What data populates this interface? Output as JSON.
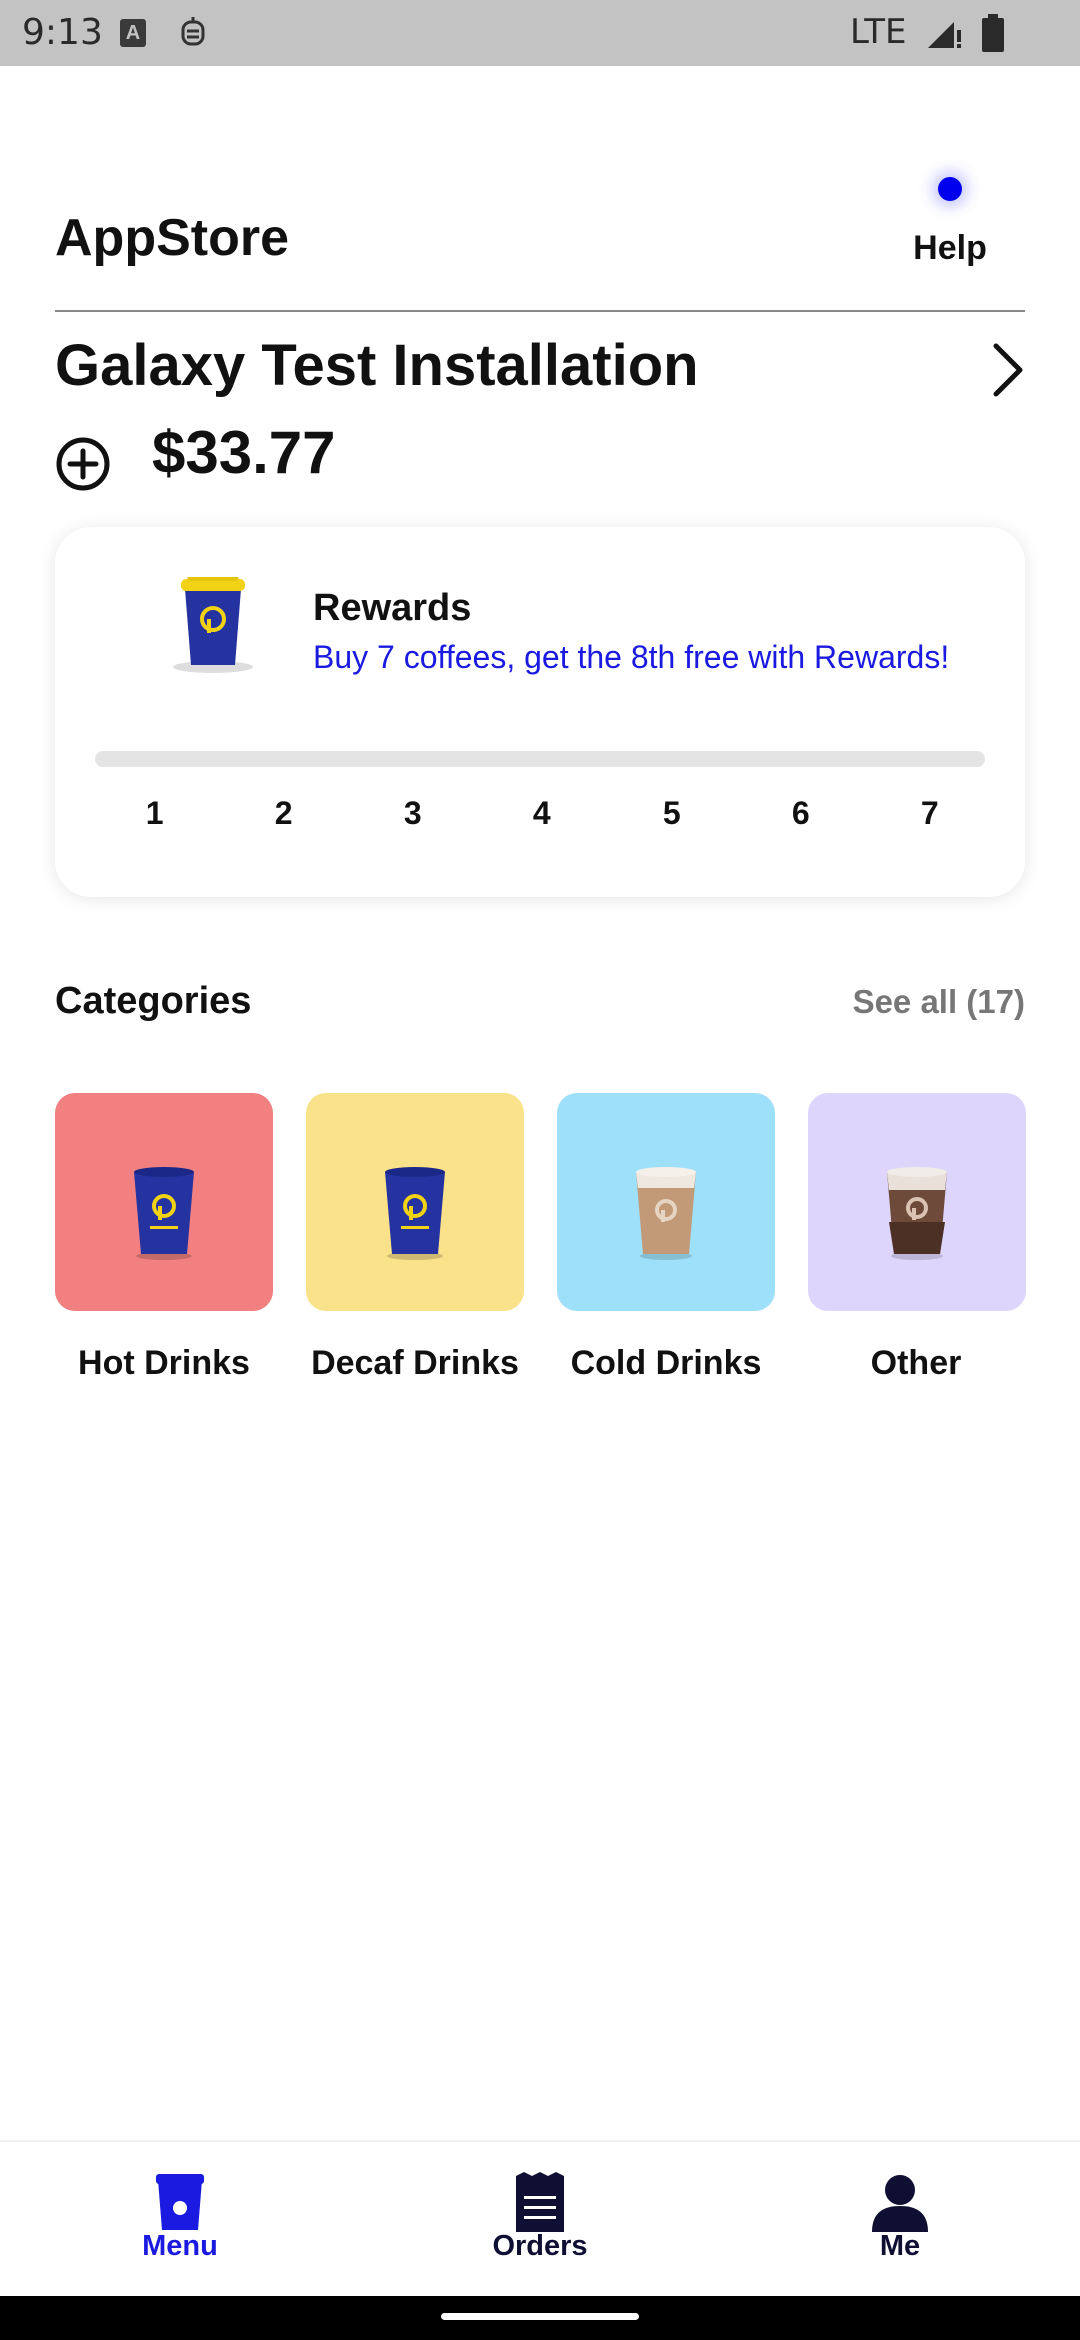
{
  "status_bar": {
    "time": "9:13",
    "network": "LTE",
    "a_icon": "A"
  },
  "header": {
    "title": "AppStore",
    "help_label": "Help"
  },
  "store": {
    "name": "Galaxy Test Installation",
    "balance": "$33.77"
  },
  "rewards": {
    "title": "Rewards",
    "subtitle": "Buy 7 coffees, get the 8th free with Rewards!",
    "progress": 0,
    "steps": [
      "1",
      "2",
      "3",
      "4",
      "5",
      "6",
      "7"
    ]
  },
  "categories": {
    "title": "Categories",
    "see_all": "See all (17)",
    "items": [
      {
        "label": "Hot Drinks",
        "color": "#f28080",
        "icon": "hot-cup-icon"
      },
      {
        "label": "Decaf Drinks",
        "color": "#fae28a",
        "icon": "hot-cup-icon"
      },
      {
        "label": "Cold Drinks",
        "color": "#9ee0fa",
        "icon": "iced-cup-icon"
      },
      {
        "label": "Other",
        "color": "#ddd5fc",
        "icon": "iced-mocha-cup-icon"
      }
    ]
  },
  "bottom_nav": {
    "items": [
      {
        "label": "Menu",
        "active": true
      },
      {
        "label": "Orders",
        "active": false
      },
      {
        "label": "Me",
        "active": false
      }
    ],
    "active_color": "#1a1ae0",
    "inactive_color": "#0f0f33"
  },
  "colors": {
    "accent": "#1a1ae0",
    "help_dot": "#0000ee"
  }
}
